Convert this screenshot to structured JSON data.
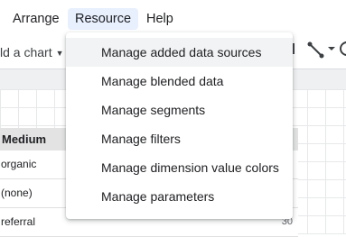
{
  "menubar": {
    "items": [
      {
        "label": "Arrange"
      },
      {
        "label": "Resource",
        "active": true
      },
      {
        "label": "Help"
      }
    ]
  },
  "toolbar": {
    "add_chart_label": "ld a chart",
    "icons": [
      "caret-down-icon",
      "line-connector-icon",
      "line-caret-icon",
      "circle-shape-icon"
    ]
  },
  "table": {
    "header": "Medium",
    "rows": [
      {
        "label": "organic",
        "value": ""
      },
      {
        "label": "(none)",
        "value": ""
      },
      {
        "label": "referral",
        "value": "30"
      }
    ]
  },
  "dropdown": {
    "items": [
      {
        "label": "Manage added data sources",
        "hovered": true
      },
      {
        "label": "Manage blended data"
      },
      {
        "label": "Manage segments"
      },
      {
        "label": "Manage filters"
      },
      {
        "label": "Manage dimension value colors"
      },
      {
        "label": "Manage parameters"
      }
    ]
  },
  "colors": {
    "menu_active_bg": "#e8f0fe",
    "hover_bg": "#f1f3f4",
    "table_header_bg": "#e3e3e3",
    "canvas_bg": "#eef0f2"
  }
}
